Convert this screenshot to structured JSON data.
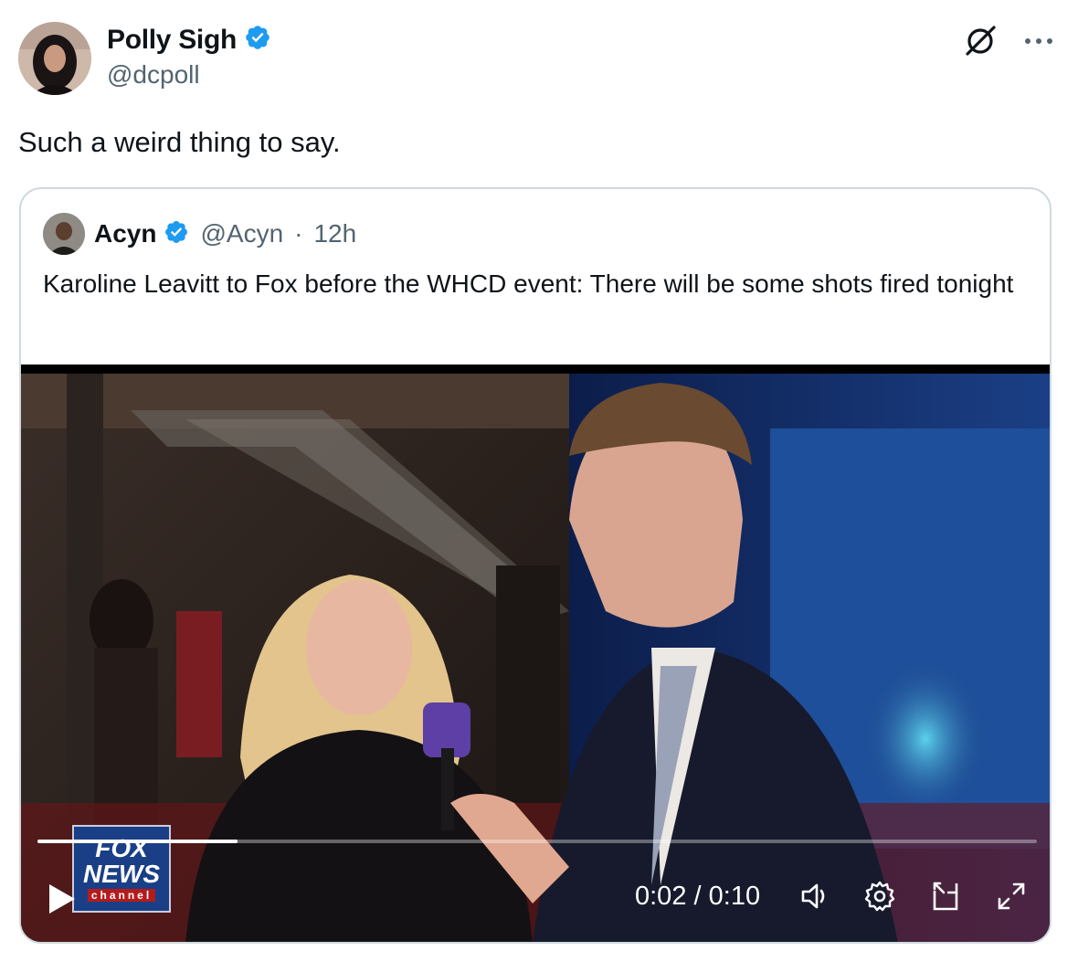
{
  "post": {
    "author_name": "Polly Sigh",
    "author_handle": "@dcpoll",
    "text": "Such a weird thing to say."
  },
  "quoted": {
    "author_name": "Acyn",
    "author_handle": "@Acyn",
    "separator": "·",
    "timestamp": "12h",
    "text": "Karoline Leavitt to Fox before the WHCD event: There will be some shots fired tonight"
  },
  "video": {
    "current_time": "0:02",
    "time_separator": "/",
    "duration": "0:10",
    "progress": 0.2,
    "watermark_line1": "FOX",
    "watermark_line2": "NEWS",
    "watermark_line3": "channel"
  },
  "icons": {
    "verified": "verified-badge-icon",
    "grok": "grok-icon",
    "more": "more-icon",
    "play": "play-icon",
    "volume": "volume-icon",
    "settings": "settings-icon",
    "pip": "picture-in-picture-icon",
    "fullscreen": "fullscreen-icon"
  },
  "colors": {
    "verified_blue": "#1d9bf0",
    "secondary_text": "#536471",
    "border": "#cfd9de"
  }
}
